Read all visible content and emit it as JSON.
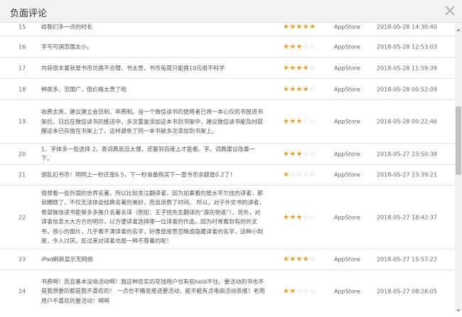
{
  "window": {
    "title": "负面评论",
    "close_icon": "close-icon"
  },
  "colors": {
    "star_on": "#f0a020",
    "star_off": "#c9c9c9"
  },
  "rows": [
    {
      "index": "15",
      "text": "给我们多一点的时长",
      "rating": 5,
      "source": "AppStore",
      "time": "2018-05-28 14:30:40"
    },
    {
      "index": "16",
      "text": "字号可调范围太小。",
      "rating": 3,
      "source": "AppStore",
      "time": "2018-05-28 12:53:03"
    },
    {
      "index": "17",
      "text": "内容很丰富就是书币兑换不合理，书太贵，书币每周只能换10元很不科学",
      "rating": 4,
      "source": "AppStore",
      "time": "2018-05-28 11:59:39"
    },
    {
      "index": "18",
      "text": "种类多、范围广，但价格太贵了哈",
      "rating": 4,
      "source": "AppStore",
      "time": "2018-05-28 00:52:09"
    },
    {
      "index": "19",
      "text": "收费太贵，建议建立会员制、年费制。当一个微信读书的使用者已将一本心仪的书放进书架后，日后在微信读书的推送中，多次重复添加这本书到书架中，建议微信读书能及时提醒这本已存放在书架上了。这样避免了同一本书被多次添加到书架上。",
      "rating": 3,
      "source": "AppStore",
      "time": "2018-05-28 00:22:46"
    },
    {
      "index": "20",
      "text": "1、字体多一些选择 2、查词典反应太慢，还要到百度上才能看。字、词典建议改善一下。",
      "rating": 3,
      "source": "AppStore",
      "time": "2018-05-27 23:50:38"
    },
    {
      "index": "21",
      "text": "胡乱扣书币！明明上一秒还是6.5，下一秒准备购买下一章书币余额是0.2了！",
      "rating": 1,
      "source": "AppStore",
      "time": "2018-05-27 23:39:21"
    },
    {
      "index": "22",
      "text": "很想看一些外国的世界名著，所以比较关注翻译者，因为如果看的是水平欠佳的译者，那就糟糕了，不仅无法体会经典名著的美妙，而且浪费了时间。 所以，对于外文书的译者，希望微信读书能够多多推介名著名译（例如：王子悦先生翻译的“源氏物语”），另外，对译者信息大大方方的明示，以方便读者选择哪一位译者的作品，因为时常看到有的外文书，很小的图片，几乎看不清译者的名字，好像是故意忽略或隐藏译者的名字，这种小制度，令人讨厌。反过来对译者也是一种不尊重的呢！",
      "rating": 3,
      "source": "AppStore",
      "time": "2018-05-27 18:42:37"
    },
    {
      "index": "23",
      "text": "iPad刷新显示无网络",
      "rating": 4,
      "source": "AppStore",
      "time": "2018-05-27 15:57:22"
    },
    {
      "index": "24",
      "text": "书费啊！而且基本没啥活动啊！我这种忠实的花钱用户也有些hold不住。要活动的书也不是我想要的都是我不喜欢的！ 一点也不精准推送要活动，能不能有点电商活动思维！老用用户不喜欢的要活动！啊啊",
      "rating": 2,
      "source": "AppStore",
      "time": "2018-05-27 08:28:05"
    }
  ]
}
